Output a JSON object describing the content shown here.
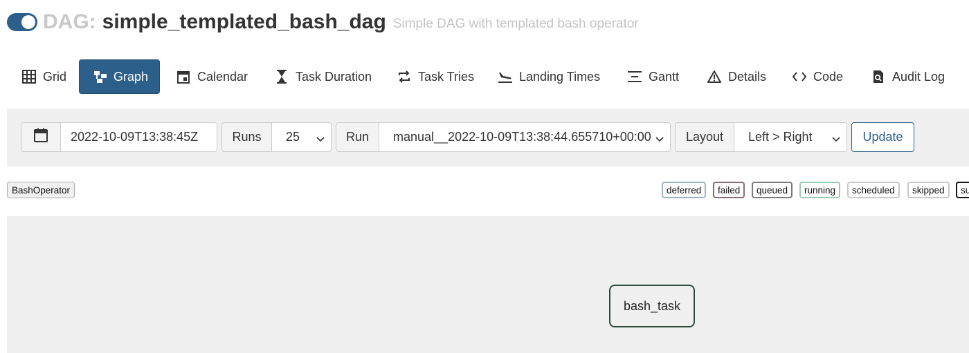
{
  "header": {
    "prefix": "DAG:",
    "dag_id": "simple_templated_bash_dag",
    "description": "Simple DAG with templated bash operator",
    "toggle_on": true
  },
  "nav": {
    "tabs": [
      {
        "label": "Grid",
        "icon": "grid-icon"
      },
      {
        "label": "Graph",
        "icon": "graph-icon",
        "active": true
      },
      {
        "label": "Calendar",
        "icon": "calendar-icon"
      },
      {
        "label": "Task Duration",
        "icon": "hourglass-icon"
      },
      {
        "label": "Task Tries",
        "icon": "repeat-icon"
      },
      {
        "label": "Landing Times",
        "icon": "plane-landing-icon"
      },
      {
        "label": "Gantt",
        "icon": "gantt-icon"
      },
      {
        "label": "Details",
        "icon": "warning-triangle-icon"
      },
      {
        "label": "Code",
        "icon": "code-icon"
      },
      {
        "label": "Audit Log",
        "icon": "document-search-icon"
      }
    ]
  },
  "filters": {
    "date_value": "2022-10-09T13:38:45Z",
    "runs_label": "Runs",
    "runs_value": "25",
    "run_label": "Run",
    "run_value": "manual__2022-10-09T13:38:44.655710+00:00",
    "layout_label": "Layout",
    "layout_value": "Left > Right",
    "update_label": "Update"
  },
  "legend": {
    "operator": "BashOperator",
    "states": [
      {
        "label": "deferred",
        "color": "#9ab6c0"
      },
      {
        "label": "failed",
        "color": "#8a6a72"
      },
      {
        "label": "queued",
        "color": "#7a7a7a"
      },
      {
        "label": "running",
        "color": "#9ccab0"
      },
      {
        "label": "scheduled",
        "color": "#c8c8c8"
      },
      {
        "label": "skipped",
        "color": "#c8c8c8"
      },
      {
        "label": "su",
        "color": "#111111"
      }
    ]
  },
  "graph": {
    "nodes": [
      {
        "label": "bash_task"
      }
    ]
  },
  "colors": {
    "accent": "#2c5f8a",
    "panel_bg": "#f0f0f0"
  }
}
